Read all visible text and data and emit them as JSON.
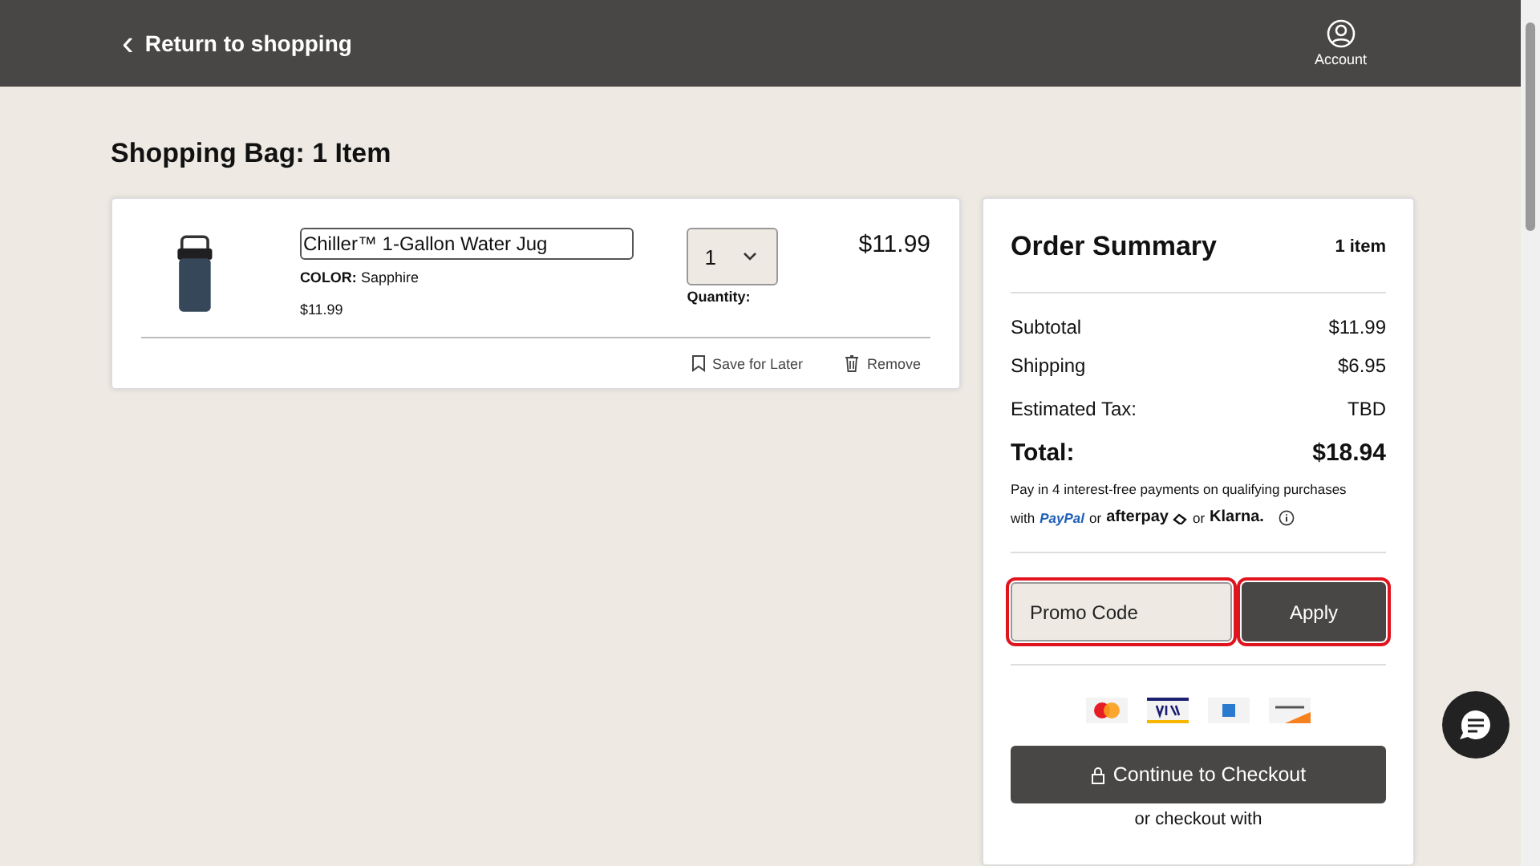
{
  "header": {
    "back_link": "Return to shopping",
    "back_icon": "‹",
    "account_label": "Account"
  },
  "page_title": "Shopping Bag: 1 Item",
  "cart_items": [
    {
      "name": "Chiller™ 1-Gallon Water Jug",
      "color_label": "COLOR:",
      "color_value": "Sapphire",
      "unit_price": "$11.99",
      "quantity": "1",
      "quantity_label": "Quantity:",
      "line_total": "$11.99",
      "save_for_later": "Save for Later",
      "remove": "Remove"
    }
  ],
  "summary": {
    "title": "Order Summary",
    "item_count": "1 item",
    "lines": [
      {
        "label": "Subtotal",
        "value": "$11.99"
      },
      {
        "label": "Shipping",
        "value": "$6.95"
      },
      {
        "label": "Estimated Tax:",
        "value": "TBD"
      }
    ],
    "total_label": "Total:",
    "total_value": "$18.94",
    "installments_text": "Pay in 4 interest-free payments on qualifying purchases",
    "installments_with": "with",
    "providers": [
      {
        "kind": "paypal",
        "name": "PayPal"
      },
      {
        "kind": "afterpay",
        "name": "afterpay",
        "prefix": "or"
      },
      {
        "kind": "klarna",
        "name": "Klarna.",
        "prefix": "or"
      }
    ],
    "promo": {
      "placeholder": "Promo Code",
      "button": "Apply",
      "highlighted": true
    },
    "checkout_button": "Continue to Checkout",
    "alt_checkout": "or checkout with"
  }
}
